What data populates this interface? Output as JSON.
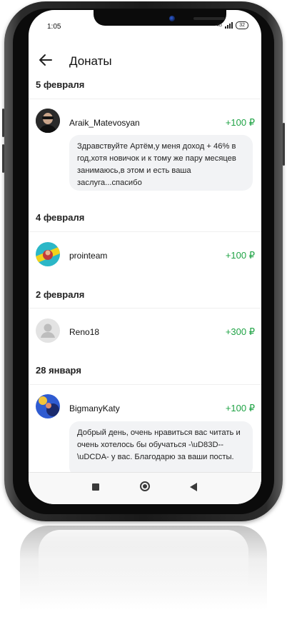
{
  "status": {
    "time": "1:05",
    "network": "4G",
    "battery": "32"
  },
  "header": {
    "title": "Донаты"
  },
  "feed": [
    {
      "date": "5 февраля",
      "donor": "Araik_Matevosyan",
      "amount": "+100 ₽",
      "message": "Здравствуйте Артём,у меня доход + 46% в год,хотя новичок и к тому же пару месяцев занимаюсь,в этом и есть ваша заслуга...спасибо"
    },
    {
      "date": "4 февраля",
      "donor": "prointeam",
      "amount": "+100 ₽"
    },
    {
      "date": "2 февраля",
      "donor": "Reno18",
      "amount": "+300 ₽"
    },
    {
      "date": "28 января",
      "donor": "BigmanyKaty",
      "amount": "+100 ₽",
      "message": "Добрый день, очень нравиться вас читать и очень хотелось бы обучаться -\\uD83D--\\uDCDA- у вас. Благодарю за ваши посты."
    }
  ],
  "icons": {
    "back": "arrow-left-icon",
    "nav_recent": "square-icon",
    "nav_home": "circle-icon",
    "nav_back": "triangle-icon"
  },
  "colors": {
    "amount": "#1fa345",
    "bubble": "#f2f3f5"
  }
}
